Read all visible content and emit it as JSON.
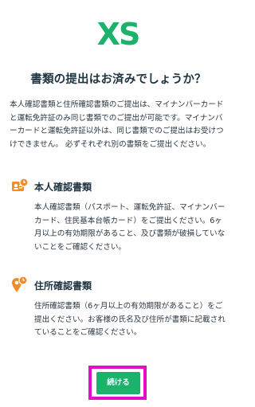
{
  "logo": {
    "text": "XS",
    "color": "#1bb26c"
  },
  "title": "書類の提出はお済みでしょうか？",
  "intro": "本人確認書類と住所確認書類のご提出は、マイナンバーカードと運転免許証のみ同じ書類でのご提出が可能です。マイナンバーカードと運転免許証以外は、同じ書類でのご提出はお受けつけできません。 必ずそれぞれ別の書類をご提出ください。",
  "sections": [
    {
      "icon": "id-card-clock-icon",
      "title": "本人確認書類",
      "text": "本人確認書類（パスポート、運転免許証、マイナンバーカード、住民基本台帳カード）をご提出ください。6ヶ月以上の有効期限があること、及び書類が破損していないことをご確認ください。"
    },
    {
      "icon": "location-clock-icon",
      "title": "住所確認書類",
      "text": "住所確認書類（6ヶ月以上の有効期限があること）をご提出ください。お客様の氏名及び住所が書類に記載されていることをご確認ください。"
    }
  ],
  "continue_button": "続ける",
  "colors": {
    "accent": "#1bb26c",
    "icon_orange": "#f28c28",
    "highlight": "#e40ec6"
  }
}
